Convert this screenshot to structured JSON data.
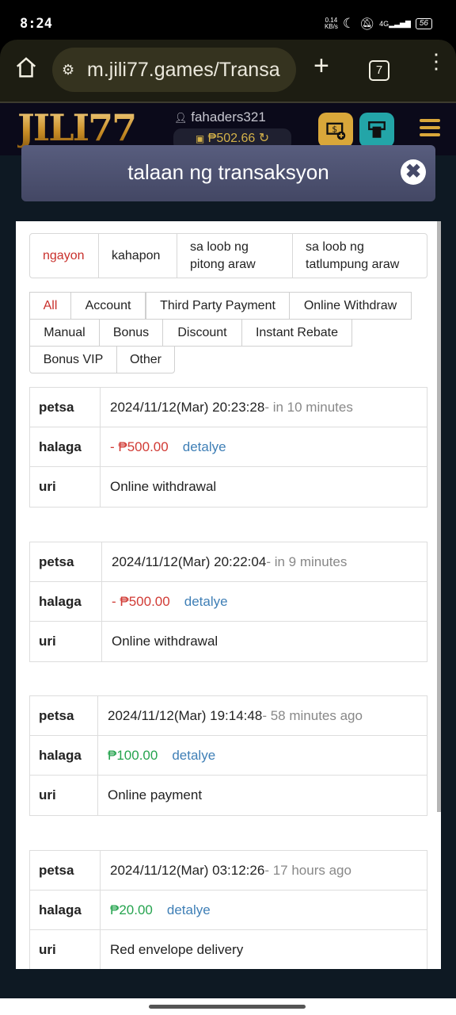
{
  "status_bar": {
    "time": "8:24",
    "net_speed_value": "0.14",
    "net_speed_unit": "KB/s",
    "network": "4G",
    "battery": "56"
  },
  "browser": {
    "url": "m.jili77.games/Transa",
    "tab_count": "7",
    "icons": [
      "home-icon",
      "site-settings-icon",
      "new-tab-icon",
      "tab-switcher-icon",
      "more-menu-icon"
    ]
  },
  "site_header": {
    "logo": "JILI77",
    "username": "fahaders321",
    "balance": "₱502.66",
    "buttons": [
      "deposit-button",
      "withdraw-button",
      "menu-button"
    ],
    "colors": {
      "gold": "#d9a73a",
      "teal": "#23a5a8"
    }
  },
  "modal": {
    "title": "talaan ng transaksyon",
    "close_label": "✖"
  },
  "date_ranges": [
    {
      "label": "ngayon",
      "active": true
    },
    {
      "label": "kahapon",
      "active": false
    },
    {
      "label": "sa loob ng pitong araw",
      "active": false
    },
    {
      "label": "sa loob ng tatlumpung araw",
      "active": false
    }
  ],
  "type_filters": [
    {
      "label": "All",
      "active": true
    },
    {
      "label": "Account",
      "active": false
    },
    {
      "label": "Third Party Payment",
      "active": false
    },
    {
      "label": "Online Withdraw",
      "active": false
    },
    {
      "label": "Manual",
      "active": false
    },
    {
      "label": "Bonus",
      "active": false
    },
    {
      "label": "Discount",
      "active": false
    },
    {
      "label": "Instant Rebate",
      "active": false
    },
    {
      "label": "Bonus VIP",
      "active": false
    },
    {
      "label": "Other",
      "active": false
    }
  ],
  "labels": {
    "date": "petsa",
    "amount": "halaga",
    "type": "uri",
    "detail_link": "detalye"
  },
  "transactions": [
    {
      "datetime": "2024/11/12(Mar) 20:23:28",
      "relative": "- in 10 minutes",
      "amount": "- ₱500.00",
      "sign": "negative",
      "type": "Online withdrawal"
    },
    {
      "datetime": "2024/11/12(Mar) 20:22:04",
      "relative": "- in 9 minutes",
      "amount": "- ₱500.00",
      "sign": "negative",
      "type": "Online withdrawal"
    },
    {
      "datetime": "2024/11/12(Mar) 19:14:48",
      "relative": "- 58 minutes ago",
      "amount": "₱100.00",
      "sign": "positive",
      "type": "Online payment"
    },
    {
      "datetime": "2024/11/12(Mar) 03:12:26",
      "relative": "- 17 hours ago",
      "amount": "₱20.00",
      "sign": "positive",
      "type": "Red envelope delivery"
    }
  ],
  "colors": {
    "negative": "#d13b35",
    "positive": "#26a44f",
    "link": "#3f7fb6",
    "active_tab": "#c9302c"
  }
}
